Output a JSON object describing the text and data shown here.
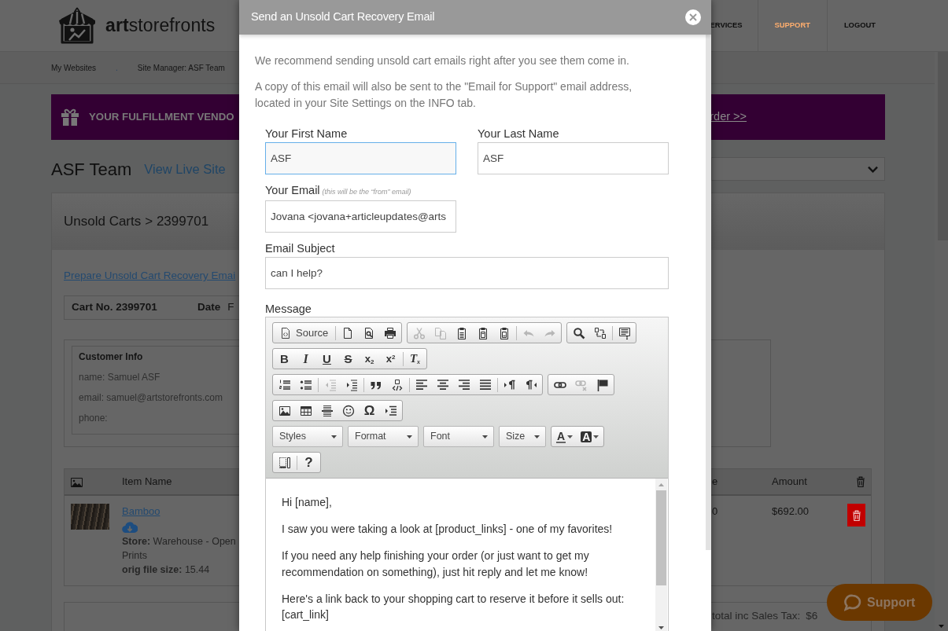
{
  "header": {
    "logo": "**art**storefronts",
    "nav": [
      {
        "label": "ERVICES",
        "selected": false
      },
      {
        "label": "SUPPORT",
        "selected": true
      },
      {
        "label": "LOGOUT",
        "selected": false
      }
    ]
  },
  "breadcrumbs": {
    "items": [
      "My Websites",
      "Site Manager: ASF Team"
    ],
    "separator": "."
  },
  "banner": {
    "text": "YOUR FULFILLMENT VENDO",
    "link": "rder >>"
  },
  "site": {
    "title": "ASF Team",
    "link": "View Live Site"
  },
  "cart": {
    "trail_link": "Unsold Carts",
    "trail_rest": "> 2399701",
    "prepare_link": "Prepare Unsold Cart Recovery Emai",
    "number": "Cart No. 2399701",
    "date_label": "Date",
    "date_value": "F",
    "customer": {
      "title": "Customer Info",
      "fields": [
        {
          "label": "name:",
          "link": "Samuel ASF"
        },
        {
          "label": "email:",
          "link": "samuel@artstorefronts.com"
        },
        {
          "label": "phone:"
        }
      ]
    },
    "table": {
      "columns": [
        "Item Name",
        "e",
        "Amount"
      ],
      "rows": [
        {
          "name": "Bamboo",
          "details": [
            "**Store:** Warehouse - Open",
            "Prints",
            "**orig file size:** 15.44"
          ],
          "price": "0",
          "amount": "$692.00"
        }
      ]
    },
    "totals": {
      "label": "total inc Sales Tax:",
      "value": "$6"
    }
  },
  "modal": {
    "title": "Send an Unsold Cart Recovery Email",
    "intro": "We recommend sending unsold cart emails right after you see them come in.",
    "note": {
      "before": "A copy of this email will also be sent to the \"Email for Support\" email address, located in your",
      "link": "Site Settings",
      "after": "on the INFO tab."
    },
    "fields": [
      {
        "label": "Your First Name",
        "value": "ASF",
        "focused": true
      },
      {
        "label": "Your Last Name",
        "value": "ASF",
        "focused": false
      },
      {
        "label": "Your Email",
        "hint": "(this will be the “from” email)",
        "value": "Jovana <jovana+articleupdates@arts",
        "focused": false
      },
      {
        "label": "Email Subject",
        "value": "can I help?",
        "focused": false
      }
    ],
    "message": {
      "label": "Message",
      "toolbar": [
        [
          [
            [
              {
                "kind": "source",
                "label": "Source",
                "disabled": false
              }
            ],
            [
              {
                "kind": "newpage",
                "disabled": false
              },
              {
                "kind": "preview",
                "disabled": false
              },
              {
                "kind": "print",
                "disabled": false
              }
            ]
          ],
          [
            [
              {
                "kind": "cut",
                "disabled": true
              },
              {
                "kind": "copy",
                "disabled": true
              },
              {
                "kind": "paste",
                "disabled": false
              },
              {
                "kind": "pastetext",
                "disabled": false
              },
              {
                "kind": "pasteword",
                "disabled": false
              }
            ],
            [
              {
                "kind": "undo",
                "disabled": true
              },
              {
                "kind": "redo",
                "disabled": true
              }
            ]
          ],
          [
            [
              {
                "kind": "find",
                "disabled": false
              },
              {
                "kind": "replace",
                "disabled": false
              }
            ],
            [
              {
                "kind": "selectall",
                "disabled": false
              }
            ]
          ]
        ],
        [
          [
            [
              {
                "kind": "bold",
                "label": "B",
                "disabled": false
              },
              {
                "kind": "italic",
                "label": "I",
                "disabled": false
              },
              {
                "kind": "underline",
                "label": "U",
                "disabled": false
              },
              {
                "kind": "strike",
                "label": "S",
                "disabled": false
              },
              {
                "kind": "subscript",
                "label": "x$_{2}$",
                "disabled": false
              },
              {
                "kind": "superscript",
                "label": "x$^{2}$",
                "disabled": false
              }
            ],
            [
              {
                "kind": "removeformat",
                "label": "T$_{x}$",
                "disabled": false
              }
            ]
          ]
        ],
        [
          [
            [
              {
                "kind": "numlist",
                "disabled": false
              },
              {
                "kind": "bullist",
                "disabled": false
              }
            ],
            [
              {
                "kind": "outdent",
                "disabled": true
              },
              {
                "kind": "indent",
                "disabled": false
              }
            ],
            [
              {
                "kind": "blockquote",
                "disabled": false
              },
              {
                "kind": "div",
                "disabled": false
              }
            ],
            [
              {
                "kind": "alignleft",
                "disabled": false
              },
              {
                "kind": "aligncenter",
                "disabled": false
              },
              {
                "kind": "alignright",
                "disabled": false
              },
              {
                "kind": "justify",
                "disabled": false
              }
            ],
            [
              {
                "kind": "ltr",
                "disabled": false
              },
              {
                "kind": "rtl",
                "disabled": false
              }
            ]
          ],
          [
            [
              {
                "kind": "link",
                "disabled": false
              },
              {
                "kind": "unlink",
                "disabled": true
              },
              {
                "kind": "anchor",
                "disabled": false
              }
            ]
          ]
        ],
        [
          [
            [
              {
                "kind": "image",
                "disabled": false
              },
              {
                "kind": "table",
                "disabled": false
              },
              {
                "kind": "hr",
                "disabled": false
              },
              {
                "kind": "smiley",
                "disabled": false
              },
              {
                "kind": "specialchar",
                "label": "Ω",
                "disabled": false
              },
              {
                "kind": "pagebreak",
                "disabled": false
              }
            ]
          ]
        ],
        [
          [
            [
              {
                "kind": "styles",
                "label": "Styles",
                "disabled": false
              }
            ]
          ],
          [
            [
              {
                "kind": "format",
                "label": "Format",
                "disabled": false
              }
            ]
          ],
          [
            [
              {
                "kind": "font",
                "label": "Font",
                "disabled": false
              }
            ]
          ],
          [
            [
              {
                "kind": "size",
                "label": "Size",
                "disabled": false
              }
            ]
          ],
          [
            [
              {
                "kind": "textcolor",
                "label": "A",
                "disabled": false
              },
              {
                "kind": "bgcolor",
                "label": "A",
                "disabled": false
              }
            ]
          ]
        ],
        [
          [
            [
              {
                "kind": "showblocks",
                "disabled": false
              }
            ],
            [
              {
                "kind": "about",
                "label": "?",
                "disabled": false
              }
            ]
          ]
        ]
      ],
      "body": [
        "Hi [name],",
        "I saw you were taking a look at [product_links] - one of my favorites!",
        "If you need any help finishing your order (or just want to get my recommendation on something), just hit reply and let me know!",
        "Here's a link back to your shopping cart to reserve it before it sells out: [cart_link]"
      ]
    }
  },
  "chat_button": {
    "label": "Support"
  }
}
